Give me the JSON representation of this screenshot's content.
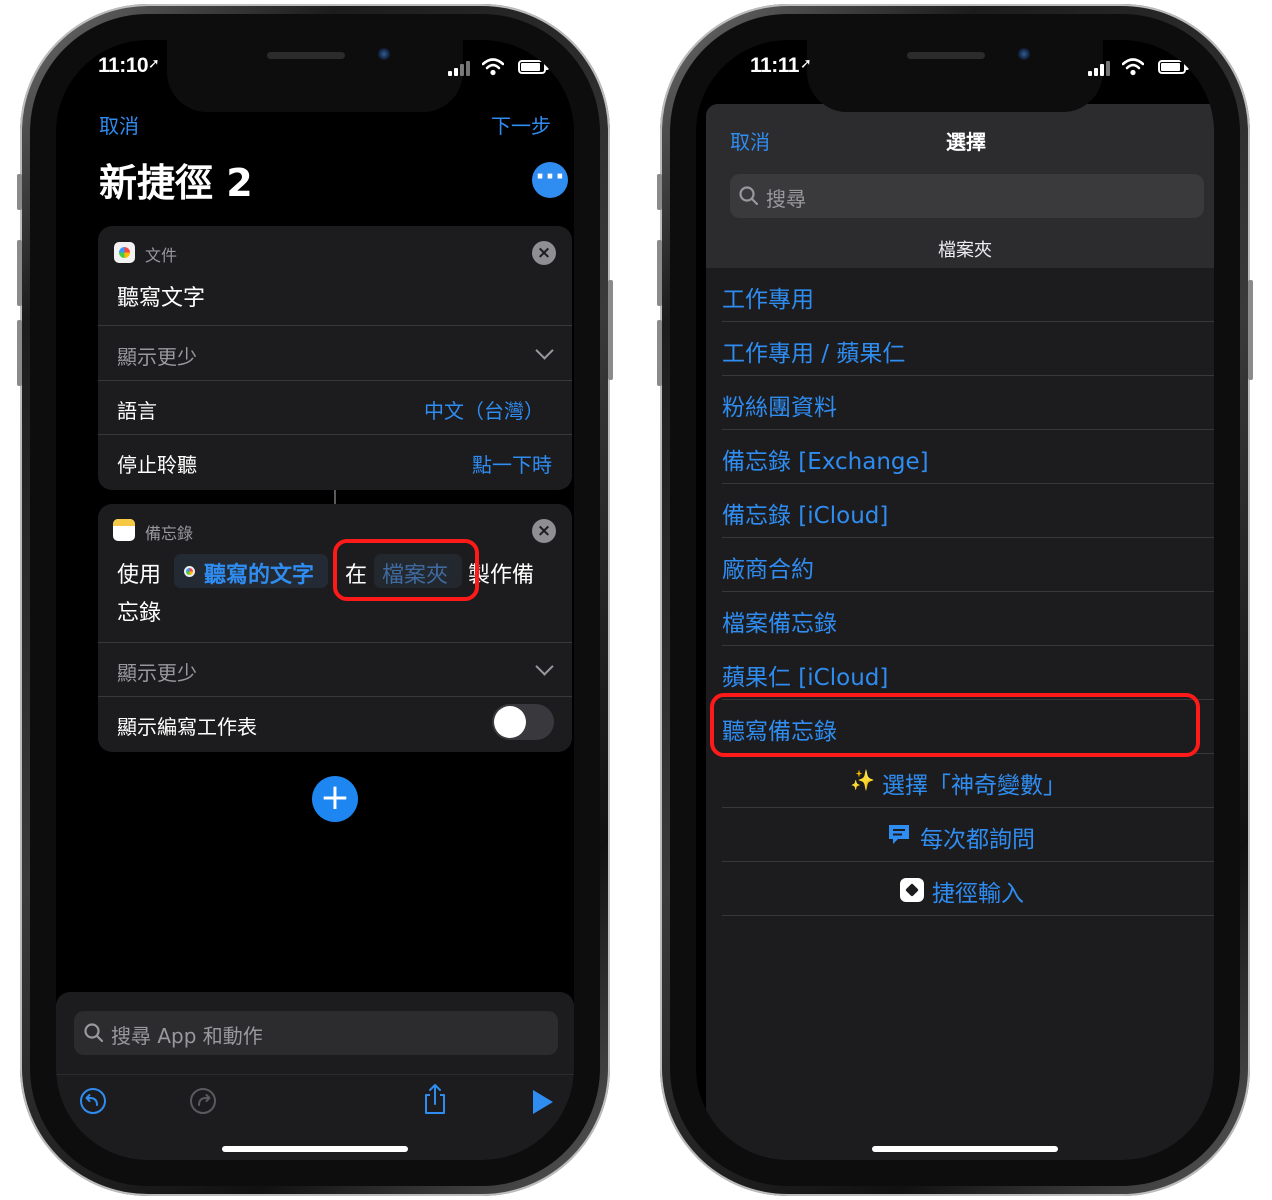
{
  "colors": {
    "accent": "#2f8cf0",
    "highlight": "#ff1a1a",
    "card": "#1c1c1e",
    "sheet": "#2c2c2e"
  },
  "left": {
    "status": {
      "time": "11:10"
    },
    "nav": {
      "cancel": "取消",
      "next": "下一步"
    },
    "title": "新捷徑 2",
    "more_icon": "ellipsis-circle-icon",
    "action1": {
      "app_label": "文件",
      "action_title": "聽寫文字",
      "show_less": "顯示更少",
      "language_label": "語言",
      "language_value": "中文（台灣）",
      "stop_label": "停止聆聽",
      "stop_value": "點一下時"
    },
    "action2": {
      "app_label": "備忘錄",
      "use": "使用",
      "variable": "聽寫的文字",
      "in": "在",
      "folder_placeholder": "檔案夾",
      "make_prefix": "製作備",
      "make_suffix": "忘錄",
      "show_less": "顯示更少",
      "compose_label": "顯示編寫工作表",
      "compose_toggle": "off"
    },
    "search_placeholder": "搜尋 App 和動作",
    "toolbar_icons": [
      "undo-icon",
      "redo-icon",
      "share-icon",
      "play-icon"
    ]
  },
  "right": {
    "status": {
      "time": "11:11"
    },
    "sheet": {
      "cancel": "取消",
      "title": "選擇",
      "search_placeholder": "搜尋",
      "section_header": "檔案夾",
      "folders": [
        "工作專用",
        "工作專用 / 蘋果仁",
        "粉絲團資料",
        "備忘錄 [Exchange]",
        "備忘錄 [iCloud]",
        "廠商合約",
        "檔案備忘錄",
        "蘋果仁 [iCloud]",
        "聽寫備忘錄"
      ],
      "options": [
        {
          "label": "選擇「神奇變數」",
          "icon": "magic-wand-icon"
        },
        {
          "label": "每次都詢問",
          "icon": "chat-bubble-icon"
        },
        {
          "label": "捷徑輸入",
          "icon": "shortcuts-icon"
        }
      ]
    }
  }
}
